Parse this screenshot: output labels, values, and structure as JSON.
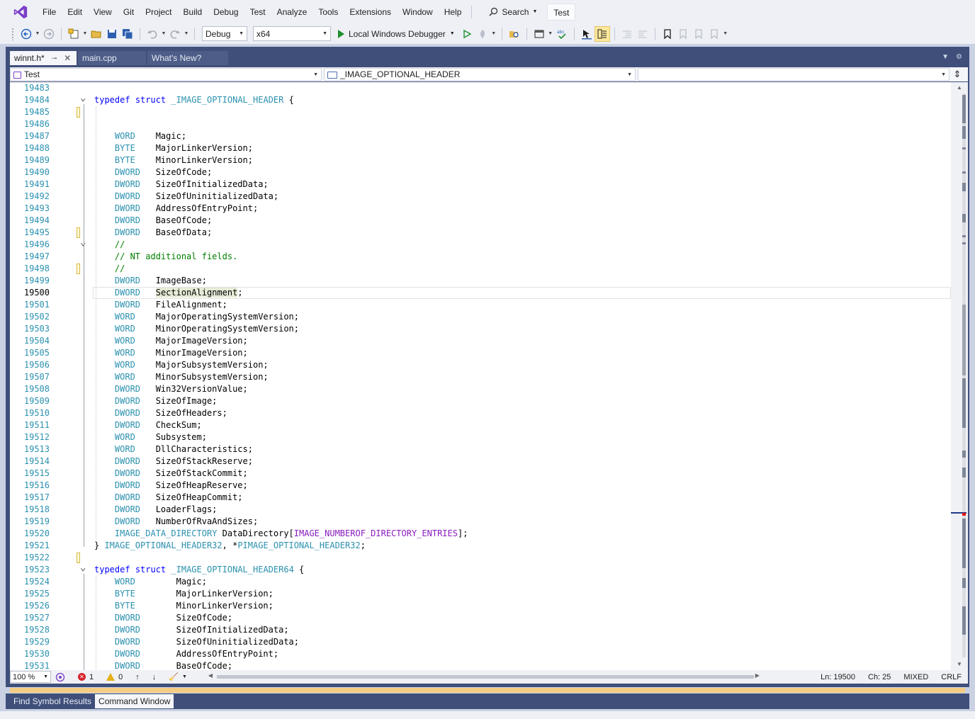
{
  "menubar": {
    "items": [
      "File",
      "Edit",
      "View",
      "Git",
      "Project",
      "Build",
      "Debug",
      "Test",
      "Analyze",
      "Tools",
      "Extensions",
      "Window",
      "Help"
    ],
    "search_label": "Search",
    "solution_name": "Test"
  },
  "toolbar": {
    "configuration": "Debug",
    "platform": "x64",
    "debugger_label": "Local Windows Debugger"
  },
  "tabs": [
    {
      "label": "winnt.h*",
      "active": true
    },
    {
      "label": "main.cpp",
      "active": false
    },
    {
      "label": "What's New?",
      "active": false
    }
  ],
  "navbar": {
    "project": "Test",
    "scope": "_IMAGE_OPTIONAL_HEADER",
    "member": ""
  },
  "editor": {
    "lines": [
      {
        "n": "19483",
        "tokens": []
      },
      {
        "n": "19484",
        "tokens": [
          [
            "kw",
            "typedef"
          ],
          [
            "t",
            " "
          ],
          [
            "kw",
            "struct"
          ],
          [
            "t",
            " "
          ],
          [
            "ty",
            "_IMAGE_OPTIONAL_HEADER"
          ],
          [
            "t",
            " {"
          ]
        ]
      },
      {
        "n": "19485",
        "tokens": []
      },
      {
        "n": "19486",
        "tokens": []
      },
      {
        "n": "19487",
        "tokens": [
          [
            "t",
            "    "
          ],
          [
            "ty",
            "WORD"
          ],
          [
            "t",
            "    Magic;"
          ]
        ]
      },
      {
        "n": "19488",
        "tokens": [
          [
            "t",
            "    "
          ],
          [
            "ty",
            "BYTE"
          ],
          [
            "t",
            "    MajorLinkerVersion;"
          ]
        ]
      },
      {
        "n": "19489",
        "tokens": [
          [
            "t",
            "    "
          ],
          [
            "ty",
            "BYTE"
          ],
          [
            "t",
            "    MinorLinkerVersion;"
          ]
        ]
      },
      {
        "n": "19490",
        "tokens": [
          [
            "t",
            "    "
          ],
          [
            "ty",
            "DWORD"
          ],
          [
            "t",
            "   SizeOfCode;"
          ]
        ]
      },
      {
        "n": "19491",
        "tokens": [
          [
            "t",
            "    "
          ],
          [
            "ty",
            "DWORD"
          ],
          [
            "t",
            "   SizeOfInitializedData;"
          ]
        ]
      },
      {
        "n": "19492",
        "tokens": [
          [
            "t",
            "    "
          ],
          [
            "ty",
            "DWORD"
          ],
          [
            "t",
            "   SizeOfUninitializedData;"
          ]
        ]
      },
      {
        "n": "19493",
        "tokens": [
          [
            "t",
            "    "
          ],
          [
            "ty",
            "DWORD"
          ],
          [
            "t",
            "   AddressOfEntryPoint;"
          ]
        ]
      },
      {
        "n": "19494",
        "tokens": [
          [
            "t",
            "    "
          ],
          [
            "ty",
            "DWORD"
          ],
          [
            "t",
            "   BaseOfCode;"
          ]
        ]
      },
      {
        "n": "19495",
        "tokens": [
          [
            "t",
            "    "
          ],
          [
            "ty",
            "DWORD"
          ],
          [
            "t",
            "   BaseOfData;"
          ]
        ]
      },
      {
        "n": "19496",
        "tokens": [
          [
            "t",
            "    "
          ],
          [
            "cm",
            "//"
          ]
        ]
      },
      {
        "n": "19497",
        "tokens": [
          [
            "t",
            "    "
          ],
          [
            "cm",
            "// NT additional fields."
          ]
        ]
      },
      {
        "n": "19498",
        "tokens": [
          [
            "t",
            "    "
          ],
          [
            "cm",
            "//"
          ]
        ]
      },
      {
        "n": "19499",
        "tokens": [
          [
            "t",
            "    "
          ],
          [
            "ty",
            "DWORD"
          ],
          [
            "t",
            "   ImageBase;"
          ]
        ]
      },
      {
        "n": "19500",
        "tokens": [
          [
            "t",
            "    "
          ],
          [
            "ty",
            "DWORD"
          ],
          [
            "t",
            "   "
          ],
          [
            "hl",
            "SectionAlignment"
          ],
          [
            "t",
            ";"
          ]
        ]
      },
      {
        "n": "19501",
        "tokens": [
          [
            "t",
            "    "
          ],
          [
            "ty",
            "DWORD"
          ],
          [
            "t",
            "   FileAlignment;"
          ]
        ]
      },
      {
        "n": "19502",
        "tokens": [
          [
            "t",
            "    "
          ],
          [
            "ty",
            "WORD"
          ],
          [
            "t",
            "    MajorOperatingSystemVersion;"
          ]
        ]
      },
      {
        "n": "19503",
        "tokens": [
          [
            "t",
            "    "
          ],
          [
            "ty",
            "WORD"
          ],
          [
            "t",
            "    MinorOperatingSystemVersion;"
          ]
        ]
      },
      {
        "n": "19504",
        "tokens": [
          [
            "t",
            "    "
          ],
          [
            "ty",
            "WORD"
          ],
          [
            "t",
            "    MajorImageVersion;"
          ]
        ]
      },
      {
        "n": "19505",
        "tokens": [
          [
            "t",
            "    "
          ],
          [
            "ty",
            "WORD"
          ],
          [
            "t",
            "    MinorImageVersion;"
          ]
        ]
      },
      {
        "n": "19506",
        "tokens": [
          [
            "t",
            "    "
          ],
          [
            "ty",
            "WORD"
          ],
          [
            "t",
            "    MajorSubsystemVersion;"
          ]
        ]
      },
      {
        "n": "19507",
        "tokens": [
          [
            "t",
            "    "
          ],
          [
            "ty",
            "WORD"
          ],
          [
            "t",
            "    MinorSubsystemVersion;"
          ]
        ]
      },
      {
        "n": "19508",
        "tokens": [
          [
            "t",
            "    "
          ],
          [
            "ty",
            "DWORD"
          ],
          [
            "t",
            "   Win32VersionValue;"
          ]
        ]
      },
      {
        "n": "19509",
        "tokens": [
          [
            "t",
            "    "
          ],
          [
            "ty",
            "DWORD"
          ],
          [
            "t",
            "   SizeOfImage;"
          ]
        ]
      },
      {
        "n": "19510",
        "tokens": [
          [
            "t",
            "    "
          ],
          [
            "ty",
            "DWORD"
          ],
          [
            "t",
            "   SizeOfHeaders;"
          ]
        ]
      },
      {
        "n": "19511",
        "tokens": [
          [
            "t",
            "    "
          ],
          [
            "ty",
            "DWORD"
          ],
          [
            "t",
            "   CheckSum;"
          ]
        ]
      },
      {
        "n": "19512",
        "tokens": [
          [
            "t",
            "    "
          ],
          [
            "ty",
            "WORD"
          ],
          [
            "t",
            "    Subsystem;"
          ]
        ]
      },
      {
        "n": "19513",
        "tokens": [
          [
            "t",
            "    "
          ],
          [
            "ty",
            "WORD"
          ],
          [
            "t",
            "    DllCharacteristics;"
          ]
        ]
      },
      {
        "n": "19514",
        "tokens": [
          [
            "t",
            "    "
          ],
          [
            "ty",
            "DWORD"
          ],
          [
            "t",
            "   SizeOfStackReserve;"
          ]
        ]
      },
      {
        "n": "19515",
        "tokens": [
          [
            "t",
            "    "
          ],
          [
            "ty",
            "DWORD"
          ],
          [
            "t",
            "   SizeOfStackCommit;"
          ]
        ]
      },
      {
        "n": "19516",
        "tokens": [
          [
            "t",
            "    "
          ],
          [
            "ty",
            "DWORD"
          ],
          [
            "t",
            "   SizeOfHeapReserve;"
          ]
        ]
      },
      {
        "n": "19517",
        "tokens": [
          [
            "t",
            "    "
          ],
          [
            "ty",
            "DWORD"
          ],
          [
            "t",
            "   SizeOfHeapCommit;"
          ]
        ]
      },
      {
        "n": "19518",
        "tokens": [
          [
            "t",
            "    "
          ],
          [
            "ty",
            "DWORD"
          ],
          [
            "t",
            "   LoaderFlags;"
          ]
        ]
      },
      {
        "n": "19519",
        "tokens": [
          [
            "t",
            "    "
          ],
          [
            "ty",
            "DWORD"
          ],
          [
            "t",
            "   NumberOfRvaAndSizes;"
          ]
        ]
      },
      {
        "n": "19520",
        "tokens": [
          [
            "t",
            "    "
          ],
          [
            "ty",
            "IMAGE_DATA_DIRECTORY"
          ],
          [
            "t",
            " DataDirectory["
          ],
          [
            "mac",
            "IMAGE_NUMBEROF_DIRECTORY_ENTRIES"
          ],
          [
            "t",
            "];"
          ]
        ]
      },
      {
        "n": "19521",
        "tokens": [
          [
            "t",
            "} "
          ],
          [
            "ty",
            "IMAGE_OPTIONAL_HEADER32"
          ],
          [
            "t",
            ", *"
          ],
          [
            "ty",
            "PIMAGE_OPTIONAL_HEADER32"
          ],
          [
            "t",
            ";"
          ]
        ]
      },
      {
        "n": "19522",
        "tokens": []
      },
      {
        "n": "19523",
        "tokens": [
          [
            "kw",
            "typedef"
          ],
          [
            "t",
            " "
          ],
          [
            "kw",
            "struct"
          ],
          [
            "t",
            " "
          ],
          [
            "ty",
            "_IMAGE_OPTIONAL_HEADER64"
          ],
          [
            "t",
            " {"
          ]
        ]
      },
      {
        "n": "19524",
        "tokens": [
          [
            "t",
            "    "
          ],
          [
            "ty",
            "WORD"
          ],
          [
            "t",
            "        Magic;"
          ]
        ]
      },
      {
        "n": "19525",
        "tokens": [
          [
            "t",
            "    "
          ],
          [
            "ty",
            "BYTE"
          ],
          [
            "t",
            "        MajorLinkerVersion;"
          ]
        ]
      },
      {
        "n": "19526",
        "tokens": [
          [
            "t",
            "    "
          ],
          [
            "ty",
            "BYTE"
          ],
          [
            "t",
            "        MinorLinkerVersion;"
          ]
        ]
      },
      {
        "n": "19527",
        "tokens": [
          [
            "t",
            "    "
          ],
          [
            "ty",
            "DWORD"
          ],
          [
            "t",
            "       SizeOfCode;"
          ]
        ]
      },
      {
        "n": "19528",
        "tokens": [
          [
            "t",
            "    "
          ],
          [
            "ty",
            "DWORD"
          ],
          [
            "t",
            "       SizeOfInitializedData;"
          ]
        ]
      },
      {
        "n": "19529",
        "tokens": [
          [
            "t",
            "    "
          ],
          [
            "ty",
            "DWORD"
          ],
          [
            "t",
            "       SizeOfUninitializedData;"
          ]
        ]
      },
      {
        "n": "19530",
        "tokens": [
          [
            "t",
            "    "
          ],
          [
            "ty",
            "DWORD"
          ],
          [
            "t",
            "       AddressOfEntryPoint;"
          ]
        ]
      },
      {
        "n": "19531",
        "tokens": [
          [
            "t",
            "    "
          ],
          [
            "ty",
            "DWORD"
          ],
          [
            "t",
            "       BaseOfCode;"
          ]
        ]
      }
    ],
    "current_line": "19500",
    "change_marks": [
      "19485",
      "19495",
      "19498",
      "19522"
    ],
    "fold_lines": [
      "19484",
      "19496",
      "19523"
    ]
  },
  "status": {
    "zoom": "100 %",
    "errors": "1",
    "warnings": "0",
    "line": "Ln: 19500",
    "char": "Ch: 25",
    "tabs_mode": "MIXED",
    "line_endings": "CRLF"
  },
  "bottom_tabs": [
    {
      "label": "Find Symbol Results",
      "active": false
    },
    {
      "label": "Command Window",
      "active": true
    }
  ],
  "colors": {
    "keyword": "#0000ff",
    "type": "#2b91af",
    "macro": "#8a1bbf",
    "comment": "#008000",
    "line_number": "#2b91af",
    "frame": "#3f4f7a"
  }
}
